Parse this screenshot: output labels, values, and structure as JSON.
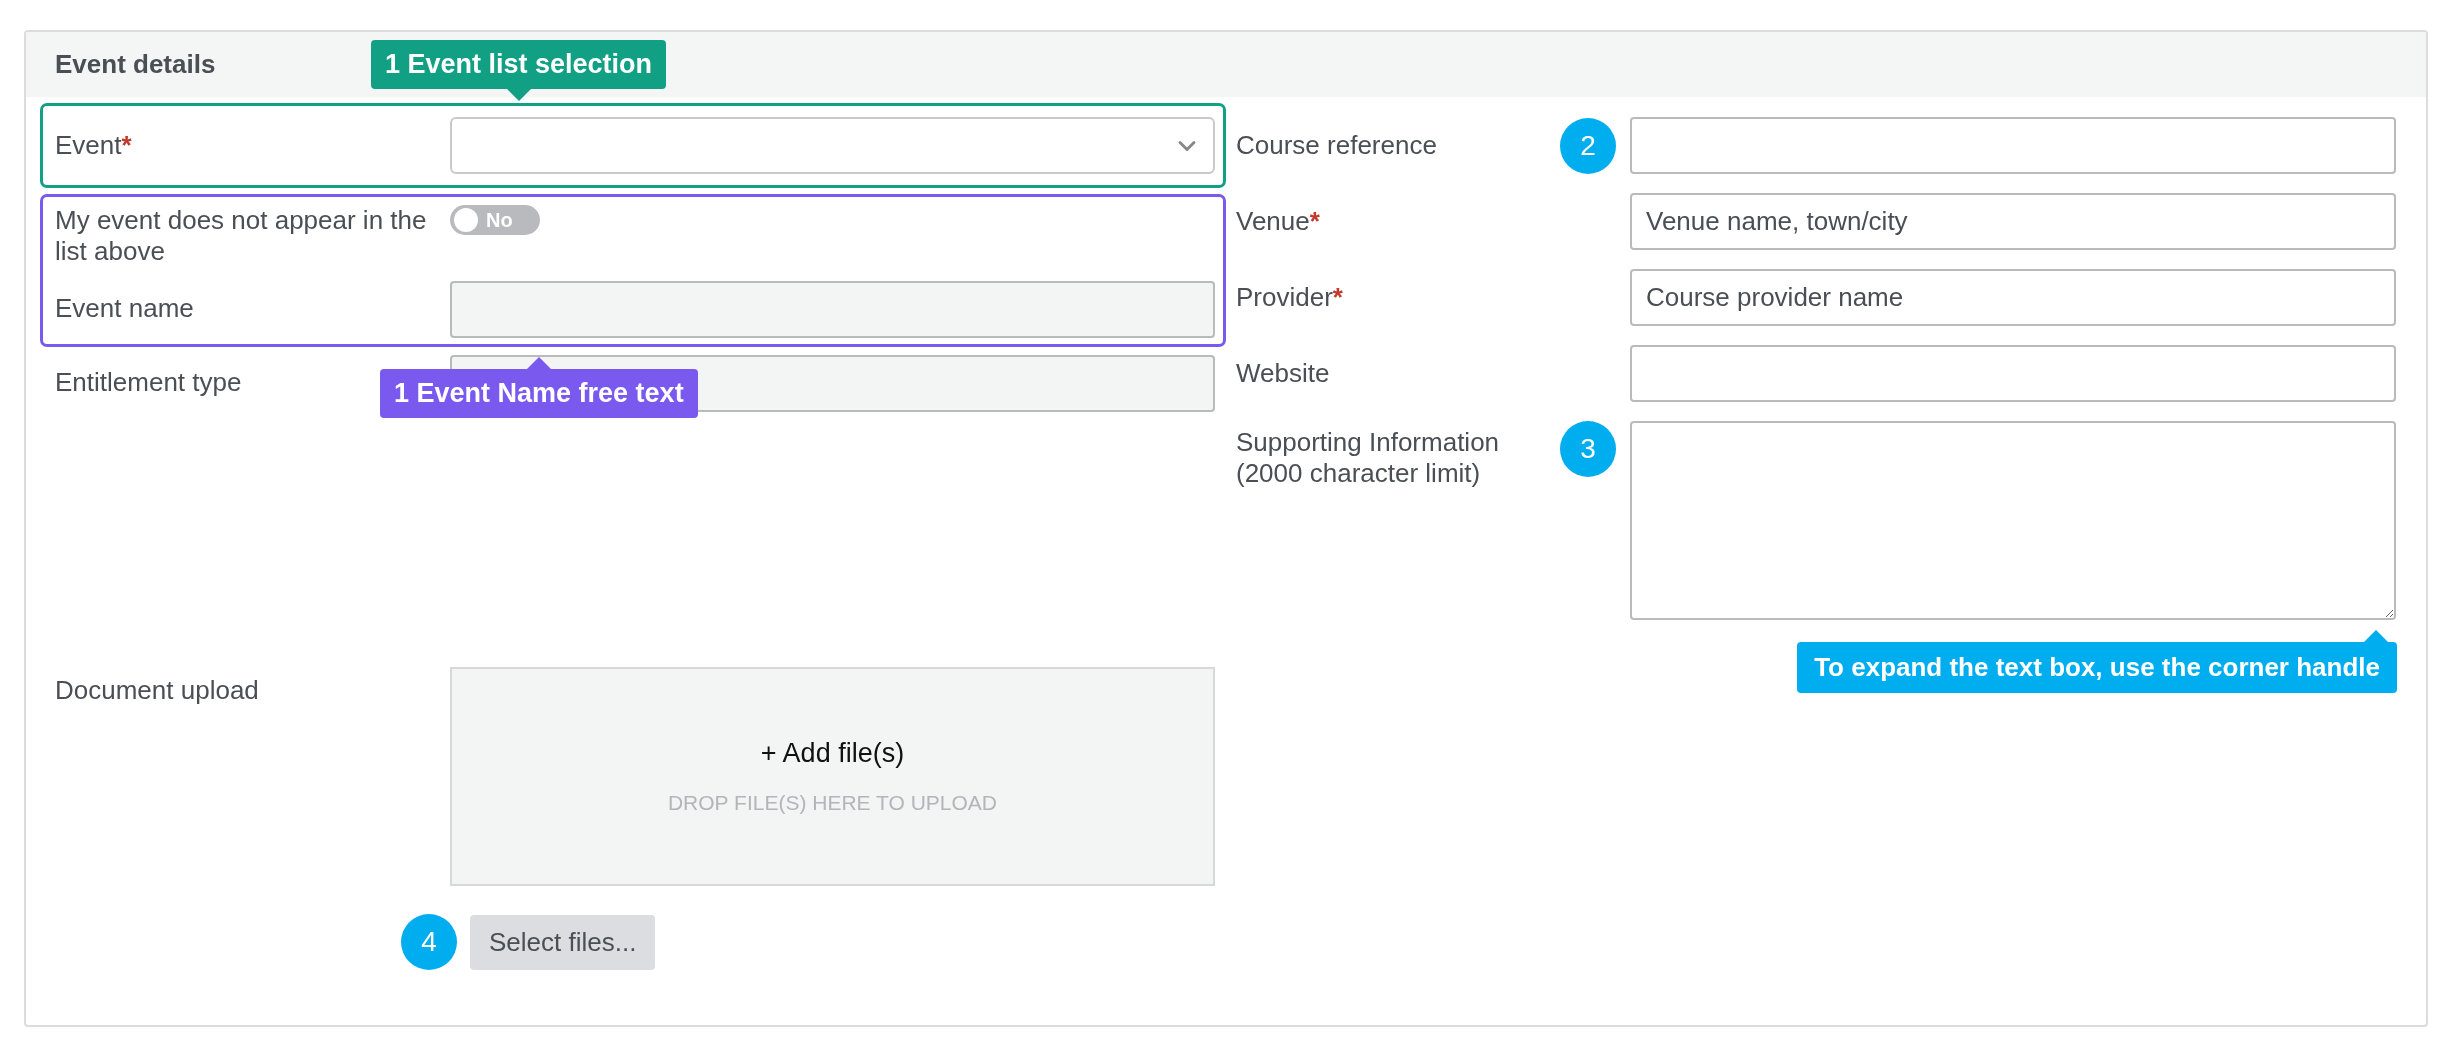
{
  "section": {
    "title": "Event details"
  },
  "event_list_group": {
    "callout": "1 Event list selection",
    "color": "#12a085",
    "fields": [
      {
        "kind": "select",
        "label": "Event",
        "asterisk": "*",
        "disabled": false
      }
    ]
  },
  "free_text_group": {
    "callout": "1 Event Name free text",
    "color": "#7a59ee",
    "fields": [
      {
        "kind": "toggle",
        "label": "My event does not appear in the list above",
        "on": false,
        "text": "No"
      },
      {
        "kind": "text",
        "label": "Event name",
        "disabled": true
      }
    ]
  },
  "other_fields": [
    {
      "kind": "text",
      "label": "Entitlement type",
      "disabled": true
    },
    {
      "kind": "upload",
      "label": "Document upload",
      "action": "+ Add file(s)",
      "hint": "DROP FILE(S) HERE TO UPLOAD",
      "button": "Select files...",
      "badge": "4"
    }
  ],
  "right_fields": [
    {
      "kind": "text",
      "label": "Course reference",
      "badge": "2",
      "disabled": false
    },
    {
      "kind": "text",
      "label": "Venue",
      "asterisk": "*",
      "placeholder": "Venue name, town/city",
      "disabled": false
    },
    {
      "kind": "text",
      "label": "Provider",
      "asterisk": "*",
      "placeholder": "Course provider name",
      "disabled": false
    },
    {
      "kind": "text",
      "label": "Website",
      "disabled": false
    },
    {
      "kind": "textarea",
      "label": "Supporting Information (2000 character limit)",
      "badge": "3",
      "tip": "To expand the text box, use the corner handle",
      "disabled": false
    }
  ]
}
